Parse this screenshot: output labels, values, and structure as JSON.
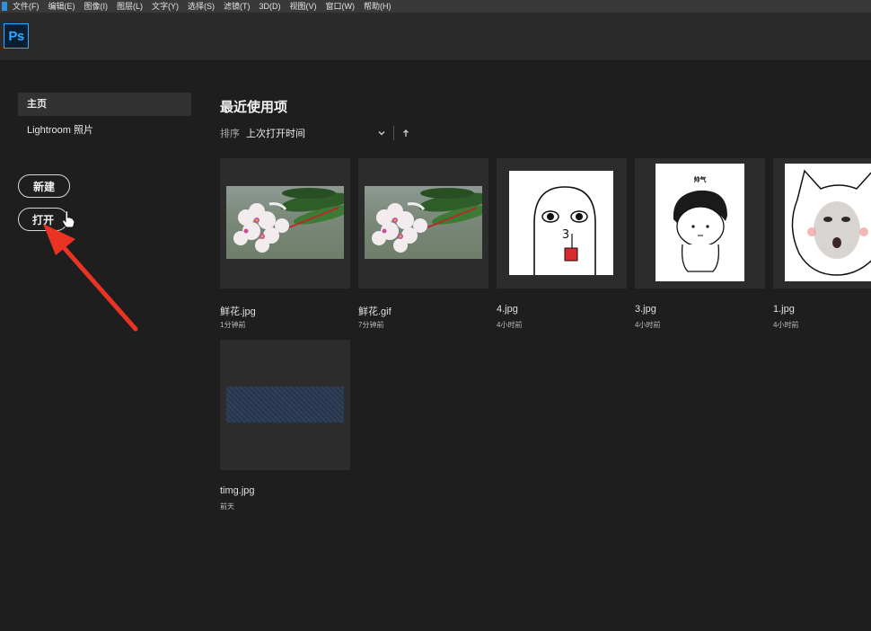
{
  "menubar": {
    "items": [
      "文件(F)",
      "编辑(E)",
      "图像(I)",
      "图层(L)",
      "文字(Y)",
      "选择(S)",
      "滤镜(T)",
      "3D(D)",
      "视图(V)",
      "窗口(W)",
      "帮助(H)"
    ]
  },
  "app": {
    "logo_text": "Ps",
    "accent": "#31a8ff"
  },
  "sidebar": {
    "home_label": "主页",
    "lightroom_label": "Lightroom 照片",
    "new_label": "新建",
    "open_label": "打开"
  },
  "main": {
    "title": "最近使用项",
    "sort_label": "排序",
    "sort_value": "上次打开时间",
    "files": [
      {
        "name": "鲜花.jpg",
        "time": "1分钟前",
        "preview": "flower"
      },
      {
        "name": "鲜花.gif",
        "time": "7分钟前",
        "preview": "flower"
      },
      {
        "name": "4.jpg",
        "time": "4小时前",
        "preview": "cartoon-drink"
      },
      {
        "name": "3.jpg",
        "time": "4小时前",
        "preview": "cartoon-shuaiqi"
      },
      {
        "name": "1.jpg",
        "time": "4小时前",
        "preview": "cartoon-cat-face"
      },
      {
        "name": "timg.jpg",
        "time": "前天",
        "preview": "dark-fabric"
      }
    ],
    "shuaiqi_caption": "帅气"
  }
}
